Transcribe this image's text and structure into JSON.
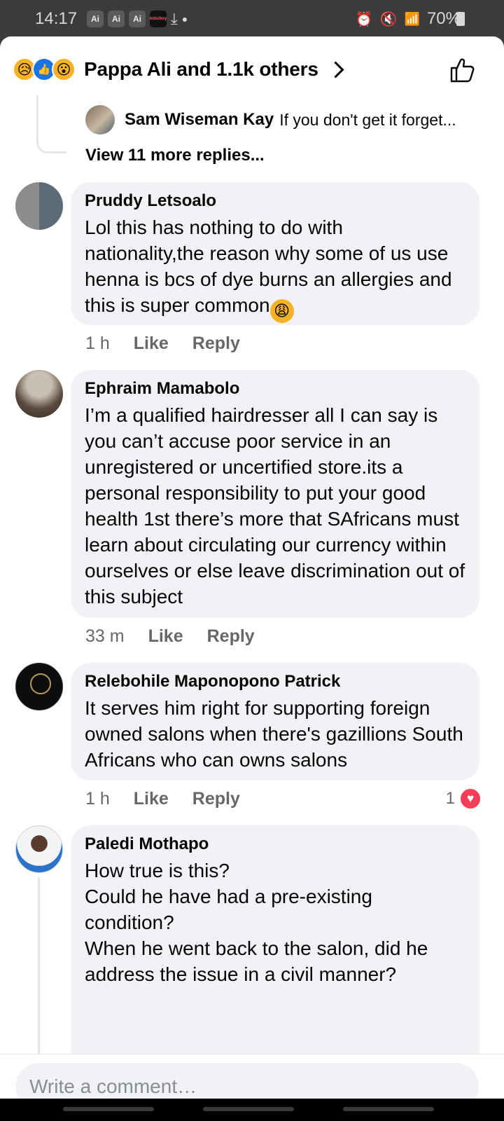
{
  "status_bar": {
    "time": "14:17",
    "app_icons": [
      "Ai",
      "Ai",
      "Ai",
      "kids/boy"
    ],
    "battery": "70%"
  },
  "reactions": {
    "summary": "Pappa Ali and 1.1k others",
    "emoji": [
      "sad",
      "like",
      "wow"
    ]
  },
  "thread_preview": {
    "author": "Sam Wiseman Kay",
    "text": "If you don't get it forget...",
    "view_more": "View 11 more replies..."
  },
  "comments": [
    {
      "name": "Pruddy Letsoalo",
      "text": "Lol this has nothing to do with nationality,the reason why some of us use henna is bcs of dye burns an allergies and this is super common",
      "emoji": "😩",
      "time": "1 h",
      "like": "Like",
      "reply": "Reply"
    },
    {
      "name": "Ephraim Mamabolo",
      "text": "I’m a qualified hairdresser all I can say is you can’t accuse poor service in an unregistered or uncertified store.its a personal responsibility to put your good health 1st there’s more that SAfricans must learn about circulating our currency within ourselves or else leave discrimination out of this subject",
      "time": "33 m",
      "like": "Like",
      "reply": "Reply"
    },
    {
      "name": "Relebohile Maponopono Patrick",
      "text": "It serves him right for supporting foreign owned salons when there's gazillions South Africans who can owns salons",
      "time": "1 h",
      "like": "Like",
      "reply": "Reply",
      "reaction_count": "1"
    },
    {
      "name": "Paledi Mothapo",
      "text": "How true is this?\nCould he have had a pre-existing condition?\nWhen he went back to the salon, did he address the issue in a civil manner?"
    }
  ],
  "composer": {
    "placeholder": "Write a comment…"
  }
}
